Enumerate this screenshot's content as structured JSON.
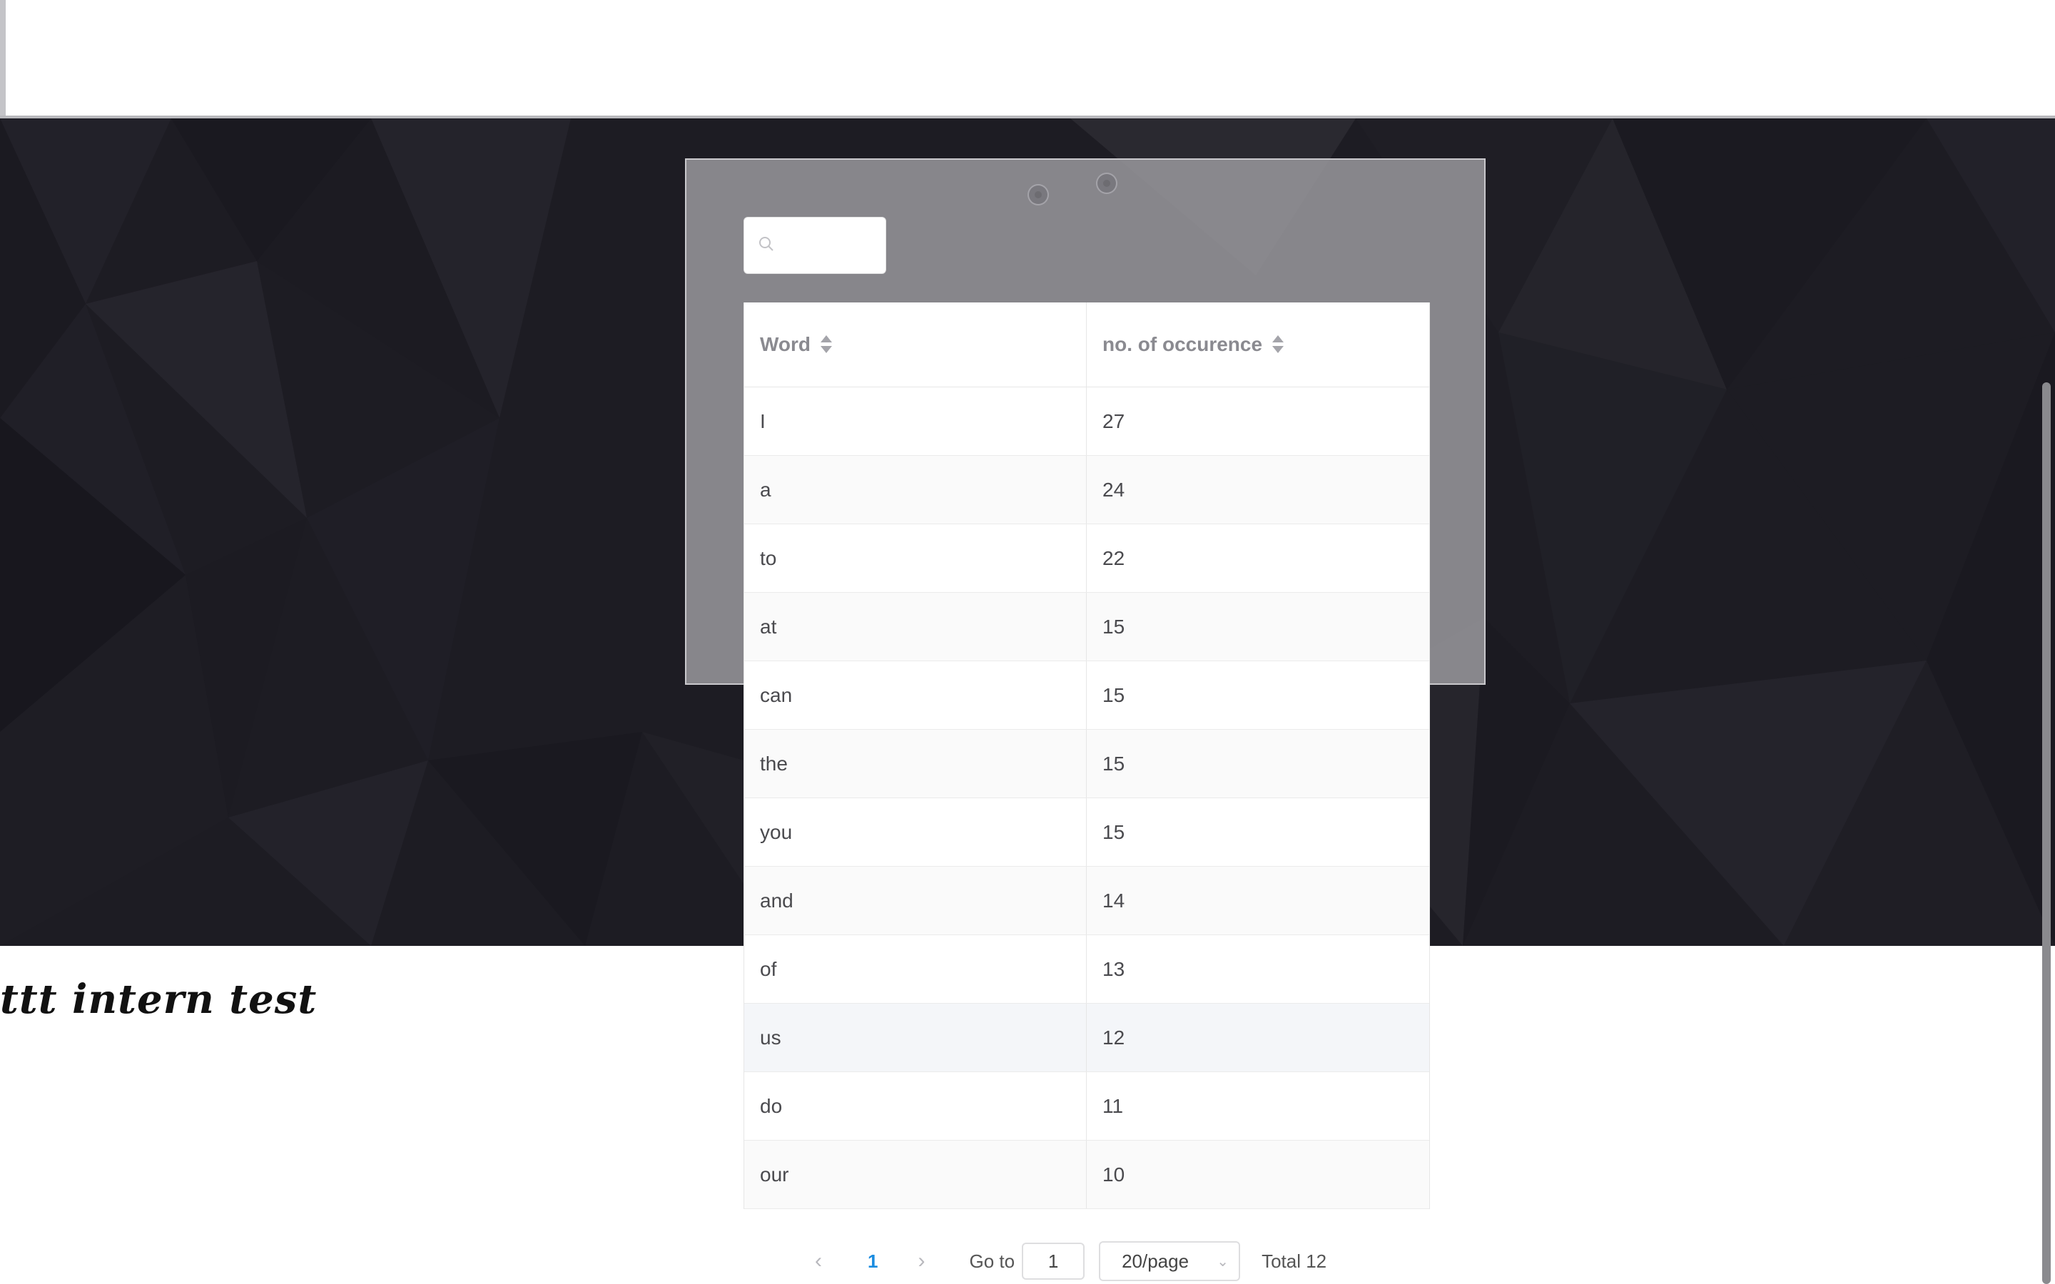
{
  "search": {
    "placeholder": "",
    "value": "",
    "icon": "search-icon"
  },
  "table": {
    "columns": [
      {
        "label": "Word",
        "sortable": true
      },
      {
        "label": "no. of occurence",
        "sortable": true
      }
    ],
    "rows": [
      {
        "word": "I",
        "count": "27"
      },
      {
        "word": "a",
        "count": "24"
      },
      {
        "word": "to",
        "count": "22"
      },
      {
        "word": "at",
        "count": "15"
      },
      {
        "word": "can",
        "count": "15"
      },
      {
        "word": "the",
        "count": "15"
      },
      {
        "word": "you",
        "count": "15"
      },
      {
        "word": "and",
        "count": "14"
      },
      {
        "word": "of",
        "count": "13"
      },
      {
        "word": "us",
        "count": "12"
      },
      {
        "word": "do",
        "count": "11"
      },
      {
        "word": "our",
        "count": "10"
      }
    ]
  },
  "caption": "ttt intern test",
  "pagination": {
    "prev_icon": "chevron-left-icon",
    "next_icon": "chevron-right-icon",
    "current_page": "1",
    "goto_label": "Go to",
    "goto_value": "1",
    "page_size": "20/page",
    "total": "Total 12"
  },
  "colors": {
    "hero_bg": "#1d1c23",
    "panel": "#96959a",
    "accent": "#1a8ce0"
  }
}
